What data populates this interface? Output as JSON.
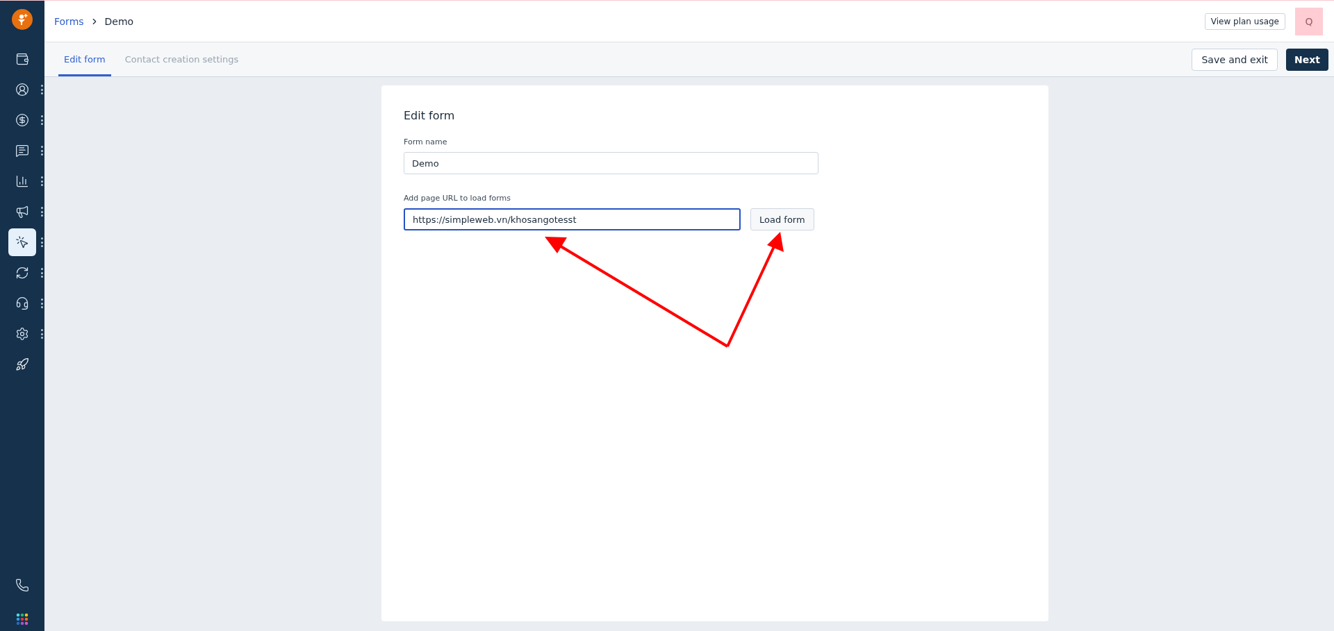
{
  "sidebar": {
    "items": [
      {
        "selected": false,
        "menu": false
      },
      {
        "selected": false,
        "menu": true
      },
      {
        "selected": false,
        "menu": true
      },
      {
        "selected": false,
        "menu": true
      },
      {
        "selected": false,
        "menu": true
      },
      {
        "selected": false,
        "menu": true
      },
      {
        "selected": true,
        "menu": true
      },
      {
        "selected": false,
        "menu": true
      },
      {
        "selected": false,
        "menu": true
      },
      {
        "selected": false,
        "menu": true
      },
      {
        "selected": false,
        "menu": false
      }
    ]
  },
  "breadcrumb": [
    "Forms",
    "Demo"
  ],
  "header": {
    "plan_button": "View plan usage",
    "avatar": "Q"
  },
  "tabs": [
    {
      "label": "Edit form",
      "selected": true
    },
    {
      "label": "Contact creation settings",
      "selected": false
    }
  ],
  "actions": {
    "save": "Save and exit",
    "next": "Next"
  },
  "card": {
    "title": "Edit form",
    "fields": [
      {
        "label": "Form name",
        "value": "Demo",
        "focused": false
      },
      {
        "label": "Add page URL to load forms",
        "value": "https://simpleweb.vn/khosangotesst",
        "focused": true,
        "button": "Load form"
      }
    ]
  }
}
